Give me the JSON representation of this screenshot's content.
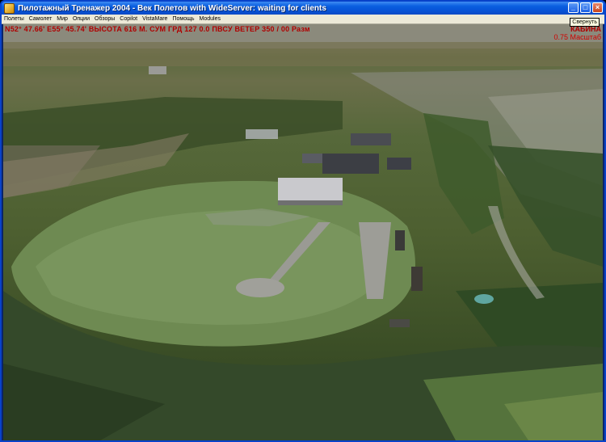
{
  "window": {
    "title": "Пилотажный Тренажер 2004 - Век Полетов with WideServer: waiting for clients",
    "tooltip": "Свернуть",
    "buttons": {
      "minimize": "_",
      "maximize": "□",
      "close": "×"
    }
  },
  "menu": {
    "items": [
      {
        "label": "Полеты"
      },
      {
        "label": "Самолет"
      },
      {
        "label": "Мир"
      },
      {
        "label": "Опции"
      },
      {
        "label": "Обзоры"
      },
      {
        "label": "Copilot"
      },
      {
        "label": "VistaMare"
      },
      {
        "label": "Помощь"
      },
      {
        "label": "Modules"
      }
    ]
  },
  "hud": {
    "status_line": "N52° 47.66'  E55° 45.74'  ВЫСОТА  616 М.  СУМ  ГРД 127   0.0 ПВСУ  ВЕТЕР 350 / 00 Разм",
    "view_mode": "КАБИНА",
    "zoom": "0.75 Масштаб"
  },
  "colors": {
    "hud_text": "#b00000",
    "titlebar": "#0a5fe0",
    "menubar_bg": "#ece9d8"
  }
}
